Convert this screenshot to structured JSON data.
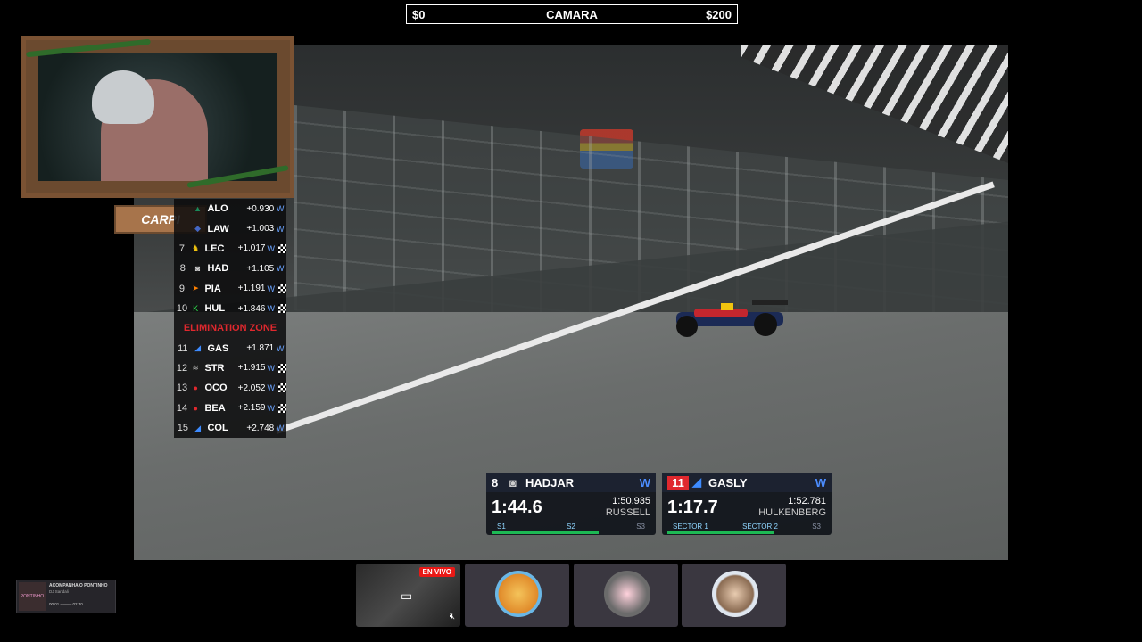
{
  "topbar": {
    "left": "$0",
    "center": "CAMARA",
    "right": "$200"
  },
  "webcam": {
    "name_plate": "CARPI"
  },
  "standings": {
    "rows_top": [
      {
        "pos": "",
        "driver": "ALO",
        "gap": "+0.930",
        "tyre": "W"
      },
      {
        "pos": "",
        "driver": "LAW",
        "gap": "+1.003",
        "tyre": "W"
      },
      {
        "pos": "7",
        "driver": "LEC",
        "gap": "+1.017",
        "tyre": "W"
      },
      {
        "pos": "8",
        "driver": "HAD",
        "gap": "+1.105",
        "tyre": "W"
      },
      {
        "pos": "9",
        "driver": "PIA",
        "gap": "+1.191",
        "tyre": "W"
      },
      {
        "pos": "10",
        "driver": "HUL",
        "gap": "+1.846",
        "tyre": "W"
      }
    ],
    "elimination_label": "ELIMINATION ZONE",
    "rows_bottom": [
      {
        "pos": "11",
        "driver": "GAS",
        "gap": "+1.871",
        "tyre": "W"
      },
      {
        "pos": "12",
        "driver": "STR",
        "gap": "+1.915",
        "tyre": "W"
      },
      {
        "pos": "13",
        "driver": "OCO",
        "gap": "+2.052",
        "tyre": "W"
      },
      {
        "pos": "14",
        "driver": "BEA",
        "gap": "+2.159",
        "tyre": "W"
      },
      {
        "pos": "15",
        "driver": "COL",
        "gap": "+2.748",
        "tyre": "W"
      }
    ]
  },
  "timing": {
    "box1": {
      "pos": "8",
      "driver": "HADJAR",
      "tyre": "W",
      "time": "1:44.6",
      "ref_time": "1:50.935",
      "ref_driver": "RUSSELL",
      "s1": "S1",
      "s2": "S2",
      "s3": "S3"
    },
    "box2": {
      "pos": "11",
      "driver": "GASLY",
      "tyre": "W",
      "time": "1:17.7",
      "ref_time": "1:52.781",
      "ref_driver": "HULKENBERG",
      "s1": "SECTOR 1",
      "s2": "SECTOR 2",
      "s3": "S3"
    }
  },
  "widget": {
    "thumb": "PONTINHO",
    "title": "ACOMPANHA O PONTINHO",
    "subtitle": "DJ Sandali",
    "progress": "00:01 ──── 02:40"
  },
  "tiles": {
    "live_badge": "EN VIVO"
  }
}
